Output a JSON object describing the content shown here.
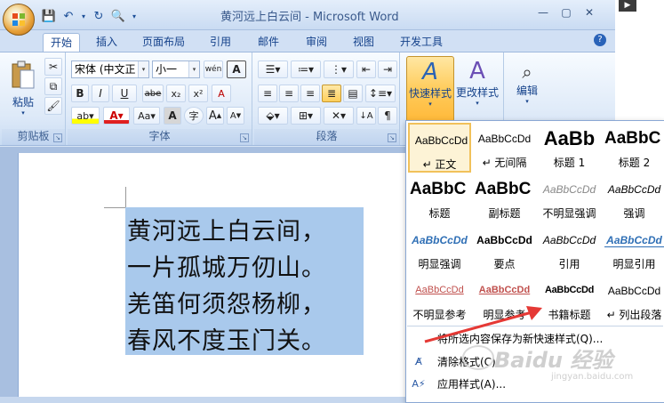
{
  "window": {
    "title": "黄河远上白云间 - Microsoft Word"
  },
  "tabs": [
    "开始",
    "插入",
    "页面布局",
    "引用",
    "邮件",
    "审阅",
    "视图",
    "开发工具"
  ],
  "ribbon": {
    "clipboard": {
      "label": "剪贴板",
      "paste": "粘贴"
    },
    "font": {
      "label": "字体",
      "font_name": "宋体 (中文正",
      "font_size": "小一",
      "bold": "B",
      "italic": "I",
      "underline": "U",
      "strike": "abe",
      "sub": "x₂",
      "sup": "x²",
      "aa": "Aa",
      "grow": "A",
      "shrink": "A",
      "char_border": "A",
      "phonetic": "wén",
      "enclose": "字",
      "clear": "A"
    },
    "paragraph": {
      "label": "段落"
    },
    "styles": {
      "quick_styles": "快速样式",
      "change_styles": "更改样式"
    },
    "editing": {
      "label": "编辑"
    }
  },
  "document": {
    "lines": [
      "黄河远上白云间，",
      "一片孤城万仞山。",
      "羌笛何须怨杨柳，",
      "春风不度玉门关。"
    ]
  },
  "styles_gallery": [
    {
      "sample": "AaBbCcDd",
      "name": "↵ 正文"
    },
    {
      "sample": "AaBbCcDd",
      "name": "↵ 无间隔"
    },
    {
      "sample": "AaBb",
      "name": "标题 1"
    },
    {
      "sample": "AaBbC",
      "name": "标题 2"
    },
    {
      "sample": "AaBbC",
      "name": "标题"
    },
    {
      "sample": "AaBbC",
      "name": "副标题"
    },
    {
      "sample": "AaBbCcDd",
      "name": "不明显强调"
    },
    {
      "sample": "AaBbCcDd",
      "name": "强调"
    },
    {
      "sample": "AaBbCcDd",
      "name": "明显强调"
    },
    {
      "sample": "AaBbCcDd",
      "name": "要点"
    },
    {
      "sample": "AaBbCcDd",
      "name": "引用"
    },
    {
      "sample": "AaBbCcDd",
      "name": "明显引用"
    },
    {
      "sample": "AaBbCcDd",
      "name": "不明显参考"
    },
    {
      "sample": "AaBbCcDd",
      "name": "明显参考"
    },
    {
      "sample": "AaBbCcDd",
      "name": "书籍标题"
    },
    {
      "sample": "AaBbCcDd",
      "name": "↵ 列出段落"
    }
  ],
  "menu": {
    "save_as_quick": "将所选内容保存为新快速样式(Q)...",
    "clear_format": "清除格式(C)",
    "apply_styles": "应用样式(A)..."
  },
  "watermark": {
    "text": "Baidu 经验",
    "sub": "jingyan.baidu.com"
  },
  "colors": {
    "accent": "#15428b",
    "selection": "#a9c9ec",
    "gallery_selected": "#f1c15a",
    "arrow": "#e53935"
  }
}
